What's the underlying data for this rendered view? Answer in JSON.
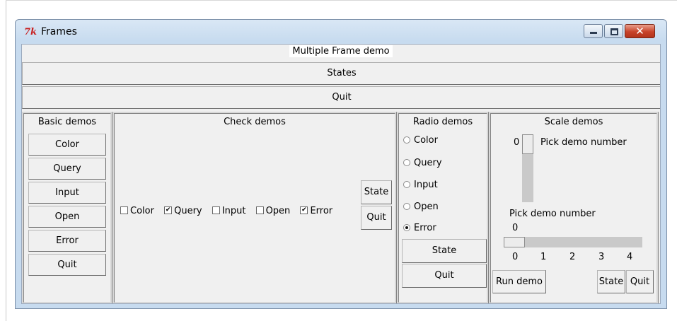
{
  "window": {
    "title": "Frames",
    "icon": "tk-feather-icon",
    "controls": {
      "minimize": "minimize-icon",
      "maximize": "maximize-icon",
      "close": "✕"
    }
  },
  "header": {
    "label": "Multiple Frame demo",
    "states_button": "States",
    "quit_button": "Quit"
  },
  "basic": {
    "title": "Basic demos",
    "buttons": [
      "Color",
      "Query",
      "Input",
      "Open",
      "Error",
      "Quit"
    ]
  },
  "check": {
    "title": "Check demos",
    "items": [
      {
        "label": "Color",
        "checked": false
      },
      {
        "label": "Query",
        "checked": true
      },
      {
        "label": "Input",
        "checked": false
      },
      {
        "label": "Open",
        "checked": false
      },
      {
        "label": "Error",
        "checked": true
      }
    ],
    "state_button": "State",
    "quit_button": "Quit"
  },
  "radio": {
    "title": "Radio demos",
    "items": [
      "Color",
      "Query",
      "Input",
      "Open",
      "Error"
    ],
    "selected": "Error",
    "state_button": "State",
    "quit_button": "Quit"
  },
  "scale": {
    "title": "Scale demos",
    "vertical": {
      "value": "0",
      "label": "Pick demo number"
    },
    "horizontal": {
      "label": "Pick demo number",
      "value": "0",
      "ticks": [
        "0",
        "1",
        "2",
        "3",
        "4"
      ]
    },
    "run_button": "Run demo",
    "state_button": "State",
    "quit_button": "Quit"
  }
}
